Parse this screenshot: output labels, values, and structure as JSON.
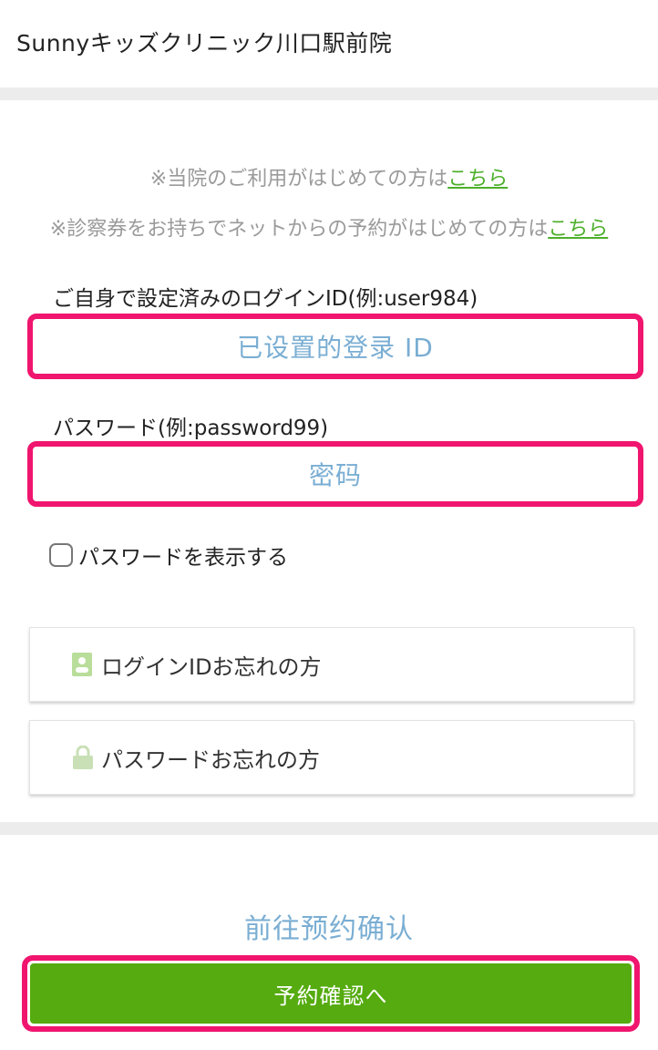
{
  "header": {
    "title": "Sunnyキッズクリニック川口駅前院"
  },
  "notices": [
    {
      "text": "※当院のご利用がはじめての方は",
      "link": "こちら"
    },
    {
      "text": "※診察券をお持ちでネットからの予約がはじめての方は",
      "link": "こちら"
    }
  ],
  "login": {
    "id_label": "ご自身で設定済みのログインID(例:user984)",
    "id_placeholder": "已设置的登录 ID",
    "password_label": "パスワード(例:password99)",
    "password_placeholder": "密码",
    "show_password_label": "パスワードを表示する"
  },
  "help_links": {
    "forgot_id": "ログインIDお忘れの方",
    "forgot_password": "パスワードお忘れの方"
  },
  "confirm": {
    "hint": "前往预约确认",
    "button_label": "予約確認へ"
  },
  "colors": {
    "accent_green": "#55ab0f",
    "link_green": "#4caf2a",
    "highlight_pink": "#f0156e",
    "placeholder_blue": "#7aaed3"
  }
}
